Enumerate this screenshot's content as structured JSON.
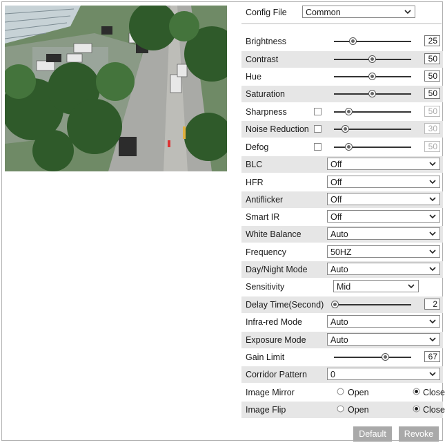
{
  "config": {
    "label": "Config File",
    "value": "Common"
  },
  "sliders": [
    {
      "label": "Brightness",
      "value": "25",
      "level": 0.25,
      "checkbox": false,
      "disabled": false
    },
    {
      "label": "Contrast",
      "value": "50",
      "level": 0.5,
      "checkbox": false,
      "disabled": false
    },
    {
      "label": "Hue",
      "value": "50",
      "level": 0.5,
      "checkbox": false,
      "disabled": false
    },
    {
      "label": "Saturation",
      "value": "50",
      "level": 0.5,
      "checkbox": false,
      "disabled": false
    },
    {
      "label": "Sharpness",
      "value": "50",
      "level": 0.2,
      "checkbox": true,
      "disabled": true
    },
    {
      "label": "Noise Reduction",
      "value": "30",
      "level": 0.15,
      "checkbox": true,
      "disabled": true
    },
    {
      "label": "Defog",
      "value": "50",
      "level": 0.2,
      "checkbox": true,
      "disabled": true
    }
  ],
  "selects": {
    "blc": {
      "label": "BLC",
      "value": "Off"
    },
    "hfr": {
      "label": "HFR",
      "value": "Off"
    },
    "antiflicker": {
      "label": "Antiflicker",
      "value": "Off"
    },
    "smart_ir": {
      "label": "Smart IR",
      "value": "Off"
    },
    "white_balance": {
      "label": "White Balance",
      "value": "Auto"
    },
    "frequency": {
      "label": "Frequency",
      "value": "50HZ"
    },
    "day_night": {
      "label": "Day/Night Mode",
      "value": "Auto"
    },
    "sensitivity": {
      "label": "Sensitivity",
      "value": "Mid"
    }
  },
  "delay_time": {
    "label": "Delay Time(Second)",
    "value": "2",
    "level": 0.02
  },
  "selects2": {
    "infrared": {
      "label": "Infra-red Mode",
      "value": "Auto"
    },
    "exposure": {
      "label": "Exposure Mode",
      "value": "Auto"
    }
  },
  "gain_limit": {
    "label": "Gain Limit",
    "value": "67",
    "level": 0.67
  },
  "corridor": {
    "label": "Corridor Pattern",
    "value": "0"
  },
  "image_mirror": {
    "label": "Image Mirror",
    "open": "Open",
    "close": "Close",
    "selected": "Close"
  },
  "image_flip": {
    "label": "Image Flip",
    "open": "Open",
    "close": "Close",
    "selected": "Close"
  },
  "buttons": {
    "default": "Default",
    "revoke": "Revoke"
  },
  "colors": {
    "shade": "#e6e6e6",
    "button": "#a9a9a9"
  }
}
